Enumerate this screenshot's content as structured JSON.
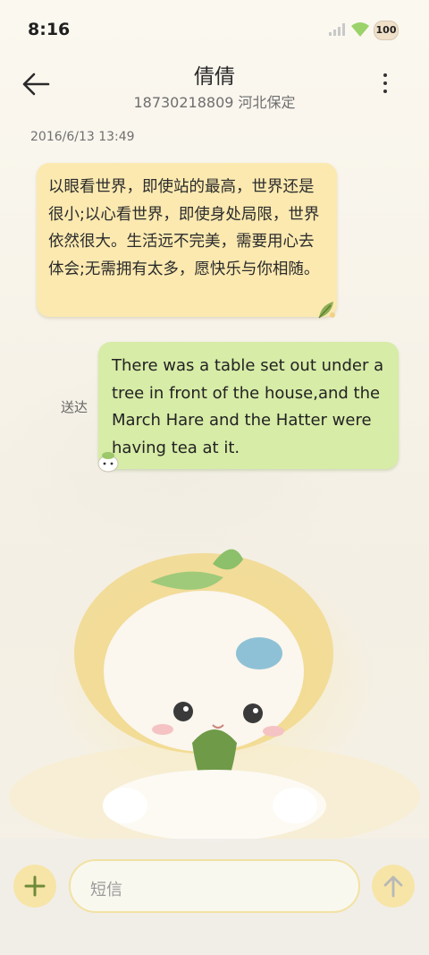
{
  "status_bar": {
    "time": "8:16",
    "battery": "100",
    "icons": [
      "signal-icon",
      "wifi-icon",
      "battery-icon"
    ]
  },
  "header": {
    "contact_name": "倩倩",
    "contact_detail": "18730218809 河北保定",
    "back_icon": "arrow-left-icon",
    "more_icon": "more-vertical-icon"
  },
  "conversation": {
    "timestamp": "2016/6/13 13:49",
    "messages": [
      {
        "direction": "incoming",
        "text": "以眼看世界，即使站的最高，世界还是很小;以心看世界，即使身处局限，世界依然很大。生活远不完美，需要用心去体会;无需拥有太多，愿快乐与你相随。"
      },
      {
        "direction": "outgoing",
        "status": "送达",
        "text": "There was a table set out under a tree in front of the house,and the March Hare and the Hatter were having tea at it."
      }
    ]
  },
  "composer": {
    "placeholder": "短信",
    "add_icon": "plus-icon",
    "send_icon": "arrow-up-icon"
  },
  "colors": {
    "incoming_bubble": "#fbe9b0",
    "outgoing_bubble": "#d7eca7",
    "accent": "#f6e5a7",
    "icon_green": "#6f8a3a"
  }
}
